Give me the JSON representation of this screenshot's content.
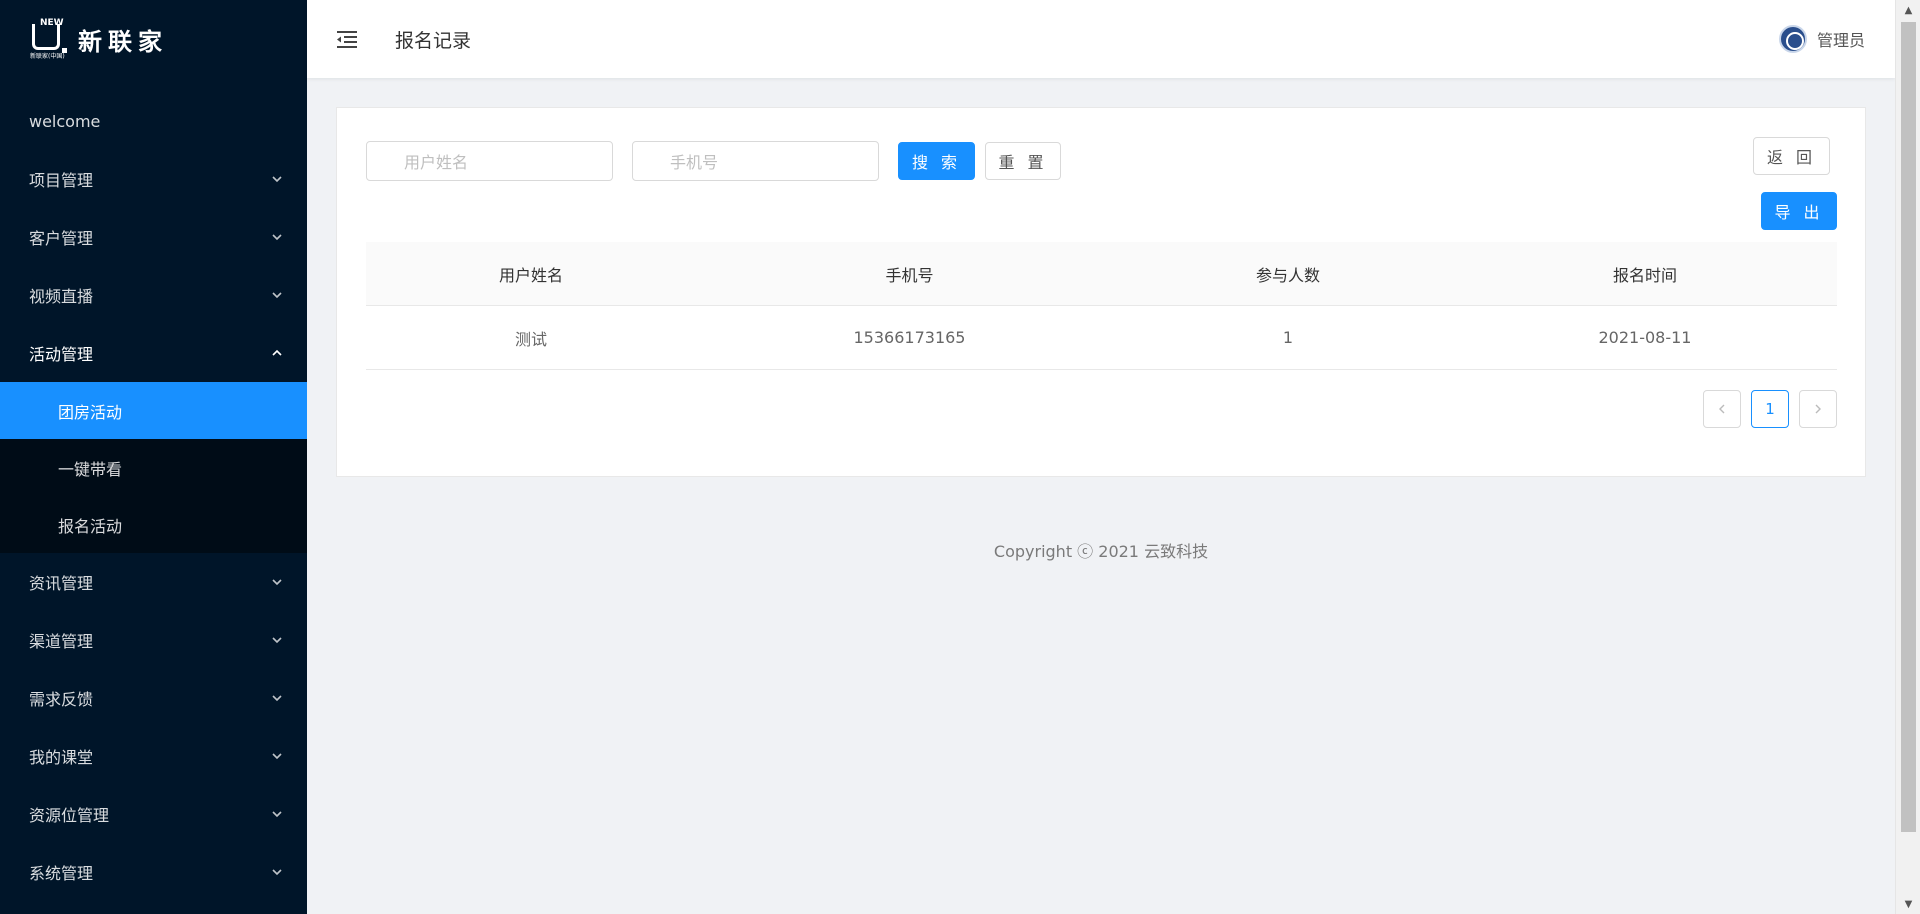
{
  "brand": {
    "name": "新联家",
    "logo_new": "NEW",
    "logo_sub": "新联家(中国)"
  },
  "sidebar": {
    "items": [
      {
        "label": "welcome"
      },
      {
        "label": "项目管理"
      },
      {
        "label": "客户管理"
      },
      {
        "label": "视频直播"
      },
      {
        "label": "活动管理"
      },
      {
        "label": "资讯管理"
      },
      {
        "label": "渠道管理"
      },
      {
        "label": "需求反馈"
      },
      {
        "label": "我的课堂"
      },
      {
        "label": "资源位管理"
      },
      {
        "label": "系统管理"
      }
    ],
    "submenu": [
      {
        "label": "团房活动"
      },
      {
        "label": "一键带看"
      },
      {
        "label": "报名活动"
      }
    ]
  },
  "header": {
    "title": "报名记录",
    "user_name": "管理员"
  },
  "search": {
    "name_placeholder": "用户姓名",
    "phone_placeholder": "手机号",
    "search_label": "搜 索",
    "reset_label": "重 置",
    "back_label": "返 回",
    "export_label": "导 出"
  },
  "table": {
    "columns": [
      "用户姓名",
      "手机号",
      "参与人数",
      "报名时间"
    ],
    "rows": [
      [
        "测试",
        "15366173165",
        "1",
        "2021-08-11"
      ]
    ]
  },
  "pagination": {
    "prev": "<",
    "current": "1",
    "next": ">"
  },
  "footer": {
    "copyright": "Copyright ⓒ 2021 云致科技"
  },
  "colors": {
    "sidebar_bg": "#001529",
    "accent": "#1890ff",
    "page_bg": "#f0f2f5"
  }
}
